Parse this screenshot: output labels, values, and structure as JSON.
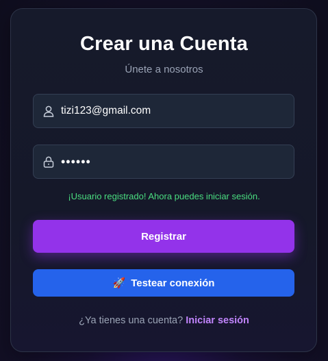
{
  "header": {
    "title": "Crear una Cuenta",
    "subtitle": "Únete a nosotros"
  },
  "form": {
    "email_value": "tizi123@gmail.com",
    "email_icon": "user-icon",
    "password_value": "••••••",
    "password_icon": "lock-icon",
    "success_message": "¡Usuario registrado! Ahora puedes iniciar sesión."
  },
  "buttons": {
    "register_label": "Registrar",
    "test_icon": "🚀",
    "test_label": "Testear conexión"
  },
  "footer": {
    "prompt": "¿Ya tienes una cuenta?",
    "login_link": "Iniciar sesión"
  },
  "colors": {
    "register": "#9333ea",
    "test": "#2563eb",
    "success": "#4ade80",
    "link": "#c084fc"
  }
}
